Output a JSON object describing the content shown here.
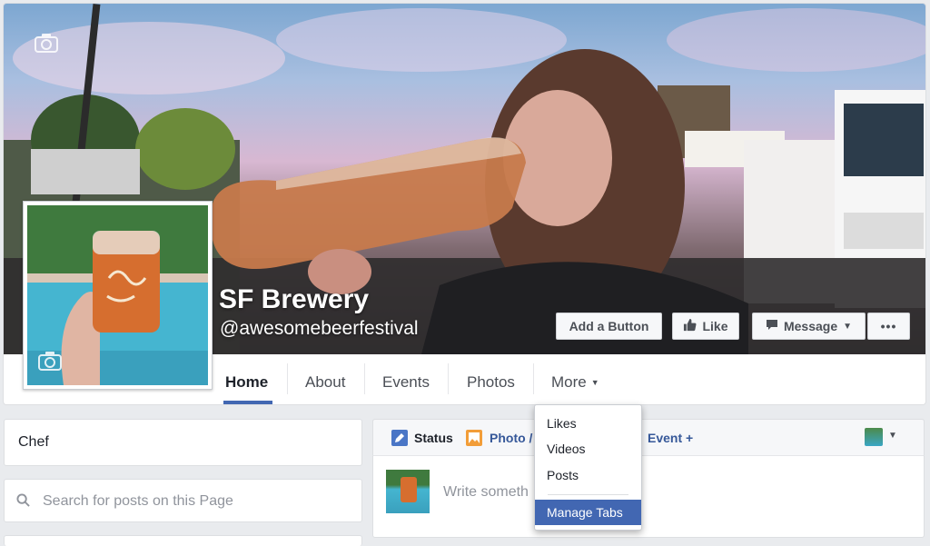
{
  "page": {
    "name": "SF Brewery",
    "handle": "@awesomebeerfestival"
  },
  "cover_buttons": {
    "add_button": "Add a Button",
    "like": "Like",
    "message": "Message",
    "more": "•••"
  },
  "tabs": [
    "Home",
    "About",
    "Events",
    "Photos",
    "More"
  ],
  "more_menu": {
    "items": [
      "Likes",
      "Videos",
      "Posts"
    ],
    "manage_tabs": "Manage Tabs"
  },
  "left": {
    "category": "Chef",
    "search_placeholder": "Search for posts on this Page"
  },
  "composer": {
    "status": "Status",
    "photo": "Photo /",
    "event": "Event +",
    "placeholder": "Write someth"
  },
  "colors": {
    "brand_blue": "#4267b2",
    "link_blue": "#365899",
    "background": "#e9ebee"
  },
  "icons": [
    "camera-icon",
    "thumbs-up-icon",
    "message-icon",
    "caret-down-icon",
    "search-icon",
    "pencil-icon",
    "photo-icon"
  ]
}
